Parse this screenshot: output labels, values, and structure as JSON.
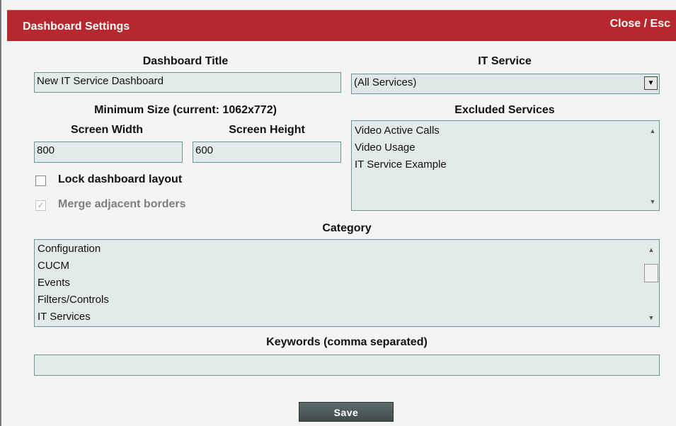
{
  "dialog": {
    "title": "Dashboard Settings",
    "close_label": "Close / Esc"
  },
  "dashboard_title": {
    "label": "Dashboard Title",
    "value": "New IT Service Dashboard"
  },
  "it_service": {
    "label": "IT Service",
    "selected": "(All Services)",
    "dropdown_icon": "triangle-down-icon"
  },
  "min_size": {
    "label": "Minimum Size (current: 1062x772)",
    "width_label": "Screen Width",
    "width_value": "800",
    "height_label": "Screen Height",
    "height_value": "600"
  },
  "excluded_services": {
    "label": "Excluded Services",
    "items": [
      "Video Active Calls",
      "Video Usage",
      "IT Service Example"
    ]
  },
  "options": {
    "lock_layout_label": "Lock dashboard layout",
    "lock_layout_checked": false,
    "merge_borders_label": "Merge adjacent borders",
    "merge_borders_checked": true,
    "merge_borders_disabled": true
  },
  "category": {
    "label": "Category",
    "items": [
      "Configuration",
      "CUCM",
      "Events",
      "Filters/Controls",
      "IT Services"
    ]
  },
  "keywords": {
    "label": "Keywords (comma separated)",
    "value": ""
  },
  "save_label": "Save",
  "colors": {
    "titlebar": "#b7282e",
    "field_bg": "#e2ebea",
    "field_border": "#6c9492",
    "save_button": "#4a5756"
  }
}
